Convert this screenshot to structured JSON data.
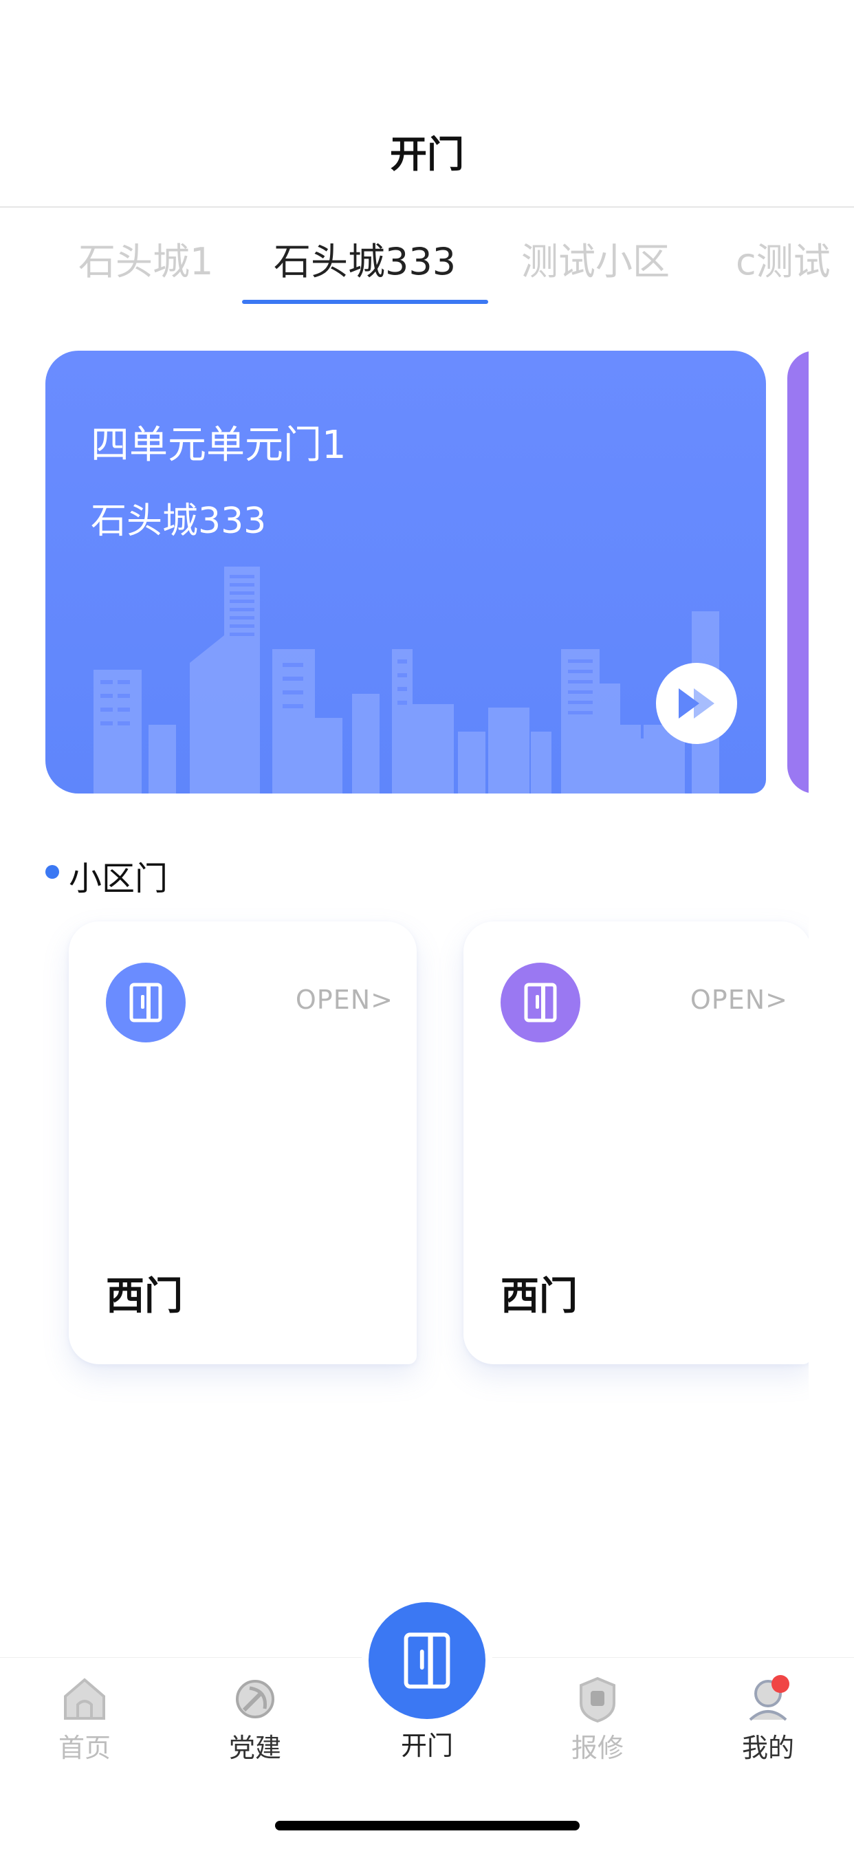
{
  "header": {
    "title": "开门"
  },
  "tabs": [
    {
      "label": "石头城1",
      "active": false
    },
    {
      "label": "石头城333",
      "active": true
    },
    {
      "label": "测试小区",
      "active": false
    },
    {
      "label": "c测试",
      "active": false
    }
  ],
  "hero": {
    "title": "四单元单元门1",
    "subtitle": "石头城333",
    "play_icon": "play-forward-icon",
    "colors": {
      "card": "#6a8cff",
      "next_card": "#9a78f2"
    }
  },
  "section": {
    "label": "小区门"
  },
  "gates": [
    {
      "name": "西门",
      "open_label": "OPEN>",
      "icon": "door-icon",
      "color": "#6a8cff"
    },
    {
      "name": "西门",
      "open_label": "OPEN>",
      "icon": "door-icon",
      "color": "#9a78f2"
    }
  ],
  "nav": {
    "items": [
      {
        "label": "首页",
        "icon": "home-icon"
      },
      {
        "label": "党建",
        "icon": "party-emblem-icon"
      },
      {
        "label": "开门",
        "icon": "door-icon",
        "active": true
      },
      {
        "label": "报修",
        "icon": "repair-icon"
      },
      {
        "label": "我的",
        "icon": "profile-icon"
      }
    ]
  },
  "colors": {
    "accent": "#3b78f3",
    "badge": "#f04545"
  }
}
